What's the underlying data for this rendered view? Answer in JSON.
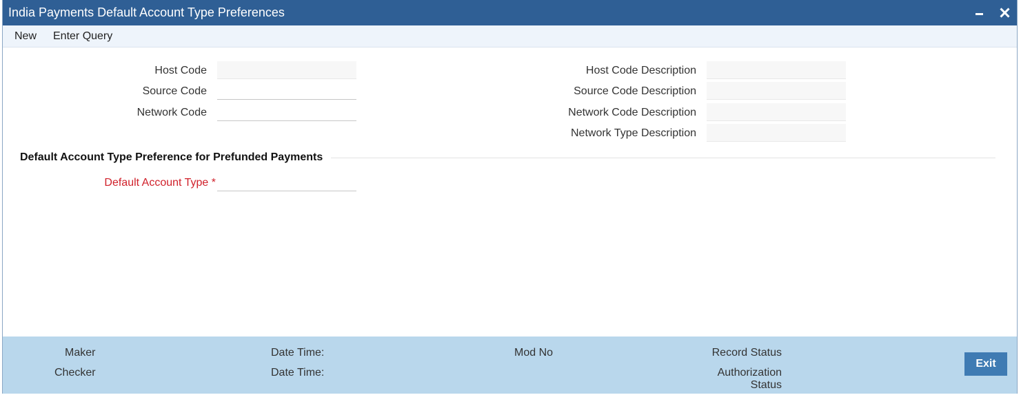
{
  "window": {
    "title": "India Payments Default Account Type Preferences"
  },
  "menu": {
    "new_label": "New",
    "enter_query_label": "Enter Query"
  },
  "form": {
    "host_code": {
      "label": "Host Code",
      "value": ""
    },
    "source_code": {
      "label": "Source Code",
      "value": ""
    },
    "network_code": {
      "label": "Network Code",
      "value": ""
    },
    "host_code_description": {
      "label": "Host Code Description",
      "value": ""
    },
    "source_code_description": {
      "label": "Source Code Description",
      "value": ""
    },
    "network_code_description": {
      "label": "Network Code Description",
      "value": ""
    },
    "network_type_description": {
      "label": "Network Type Description",
      "value": ""
    }
  },
  "section": {
    "title": "Default Account Type Preference for Prefunded Payments",
    "default_account_type": {
      "label": "Default Account Type",
      "required_mark": "*",
      "value": ""
    }
  },
  "footer": {
    "maker_label": "Maker",
    "checker_label": "Checker",
    "date_time_label_1": "Date Time:",
    "date_time_label_2": "Date Time:",
    "mod_no_label": "Mod No",
    "record_status_label": "Record Status",
    "authorization_label": "Authorization",
    "status_label": "Status",
    "exit_label": "Exit"
  },
  "colors": {
    "titlebar": "#2f5f95",
    "menubar": "#eef4fb",
    "footer": "#b9d7ec",
    "exit_button": "#3f7bb3",
    "required": "#d0202a"
  }
}
